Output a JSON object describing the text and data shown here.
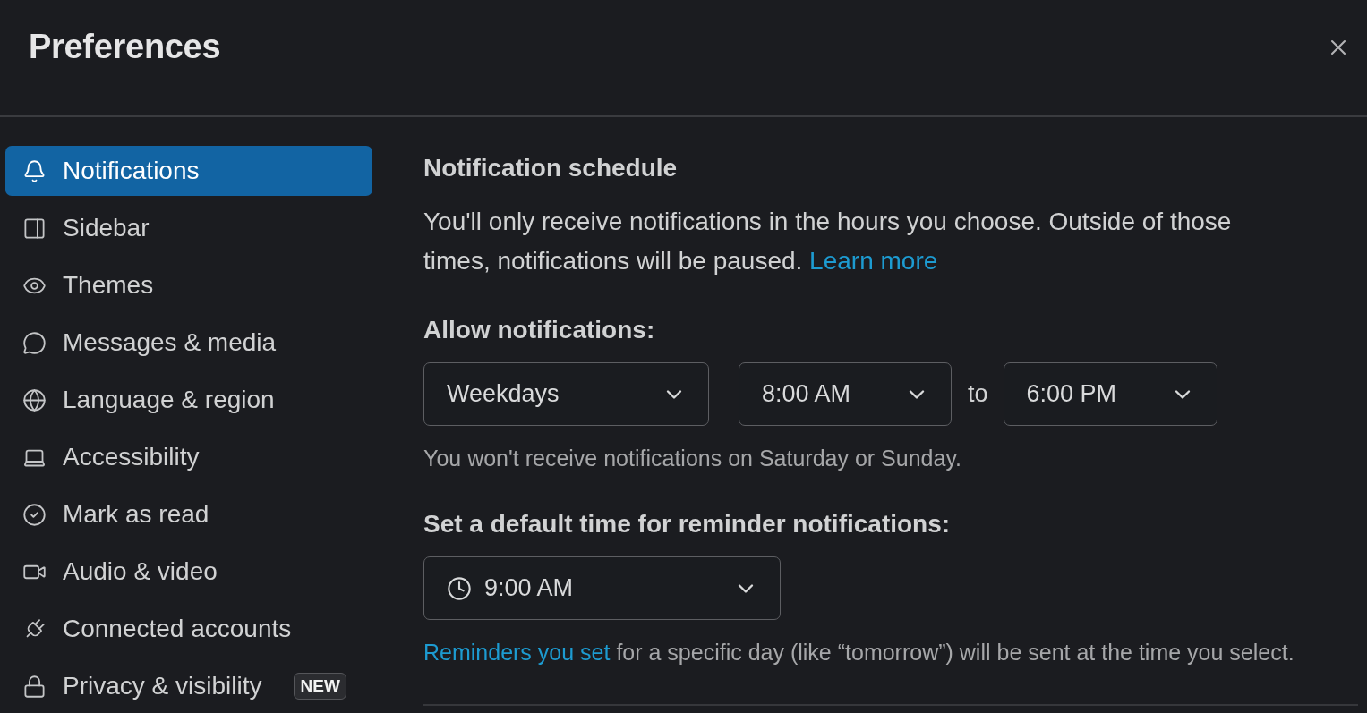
{
  "window": {
    "title": "Preferences"
  },
  "sidebar": {
    "items": [
      {
        "label": "Notifications",
        "selected": true
      },
      {
        "label": "Sidebar",
        "selected": false
      },
      {
        "label": "Themes",
        "selected": false
      },
      {
        "label": "Messages & media",
        "selected": false
      },
      {
        "label": "Language & region",
        "selected": false
      },
      {
        "label": "Accessibility",
        "selected": false
      },
      {
        "label": "Mark as read",
        "selected": false
      },
      {
        "label": "Audio & video",
        "selected": false
      },
      {
        "label": "Connected accounts",
        "selected": false
      },
      {
        "label": "Privacy & visibility",
        "selected": false,
        "badge": "NEW"
      }
    ]
  },
  "content": {
    "section_title": "Notification schedule",
    "description": {
      "text": "You'll only receive notifications in the hours you choose. Outside of those times, notifications will be paused.",
      "link": "Learn more"
    },
    "allow_label": "Allow notifications:",
    "days_select": {
      "value": "Weekdays"
    },
    "start_select": {
      "value": "8:00 AM"
    },
    "range_separator": "to",
    "end_select": {
      "value": "6:00 PM"
    },
    "allow_hint": "You won't receive notifications on Saturday or Sunday.",
    "reminder_label": "Set a default time for reminder notifications:",
    "reminder_select": {
      "value": "9:00 AM"
    },
    "reminder_note": {
      "link": "Reminders you set",
      "text": "for a specific day (like “tomorrow”) will be sent at the time you select."
    }
  }
}
